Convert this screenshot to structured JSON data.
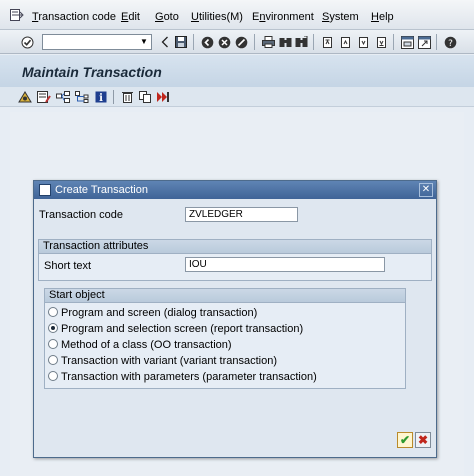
{
  "menubar": {
    "items": [
      {
        "label": "Transaction code",
        "accel": "T"
      },
      {
        "label": "Edit",
        "accel": "E"
      },
      {
        "label": "Goto",
        "accel": "G"
      },
      {
        "label": "Utilities(M)",
        "accel": "U"
      },
      {
        "label": "Environment",
        "accel": "n"
      },
      {
        "label": "System",
        "accel": "S"
      },
      {
        "label": "Help",
        "accel": "H"
      }
    ]
  },
  "toolbar": {
    "command_field_value": "",
    "icons": [
      "enter-icon",
      "save-icon",
      "back-icon",
      "exit-icon",
      "cancel-icon",
      "print-icon",
      "find-icon",
      "find-next-icon",
      "first-page-icon",
      "previous-page-icon",
      "next-page-icon",
      "last-page-icon",
      "new-session-icon",
      "shortcut-icon",
      "help-icon"
    ]
  },
  "screen": {
    "title": "Maintain Transaction"
  },
  "dialog": {
    "title": "Create Transaction",
    "transaction_code_label": "Transaction code",
    "transaction_code_value": "ZVLEDGER",
    "attributes_group_title": "Transaction attributes",
    "short_text_label": "Short text",
    "short_text_value": "IOU",
    "start_object_group_title": "Start object",
    "options": [
      {
        "label": "Program and screen (dialog transaction)",
        "selected": false
      },
      {
        "label": "Program and selection screen (report transaction)",
        "selected": true
      },
      {
        "label": "Method of a class (OO transaction)",
        "selected": false
      },
      {
        "label": "Transaction with variant (variant transaction)",
        "selected": false
      },
      {
        "label": "Transaction with parameters (parameter transaction)",
        "selected": false
      }
    ]
  },
  "colors": {
    "dialog_title_bar": "#3f6497",
    "confirm_check": "#2e9a2e",
    "cancel_x": "#c0271d"
  }
}
